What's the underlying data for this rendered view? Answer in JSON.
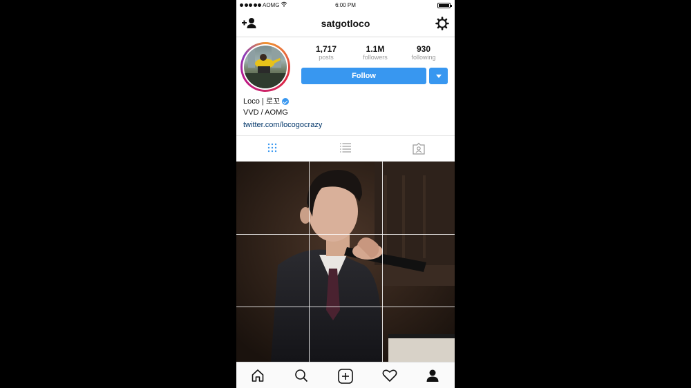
{
  "status_bar": {
    "carrier": "AOMG",
    "time": "6:00 PM"
  },
  "nav": {
    "title": "satgotloco"
  },
  "profile": {
    "stats": [
      {
        "value": "1,717",
        "label": "posts"
      },
      {
        "value": "1.1M",
        "label": "followers"
      },
      {
        "value": "930",
        "label": "following"
      }
    ],
    "follow_label": "Follow",
    "bio": {
      "name": "Loco | 로꼬",
      "line2": "VVD / AOMG",
      "link": "twitter.com/locogocrazy"
    }
  },
  "tabs": [
    "grid-view-icon",
    "list-view-icon",
    "tagged-photos-icon"
  ],
  "bottom_nav": [
    "home-icon",
    "search-icon",
    "add-post-icon",
    "heart-icon",
    "profile-icon"
  ],
  "colors": {
    "accent": "#3897f0",
    "link": "#003569",
    "muted": "#999999"
  }
}
